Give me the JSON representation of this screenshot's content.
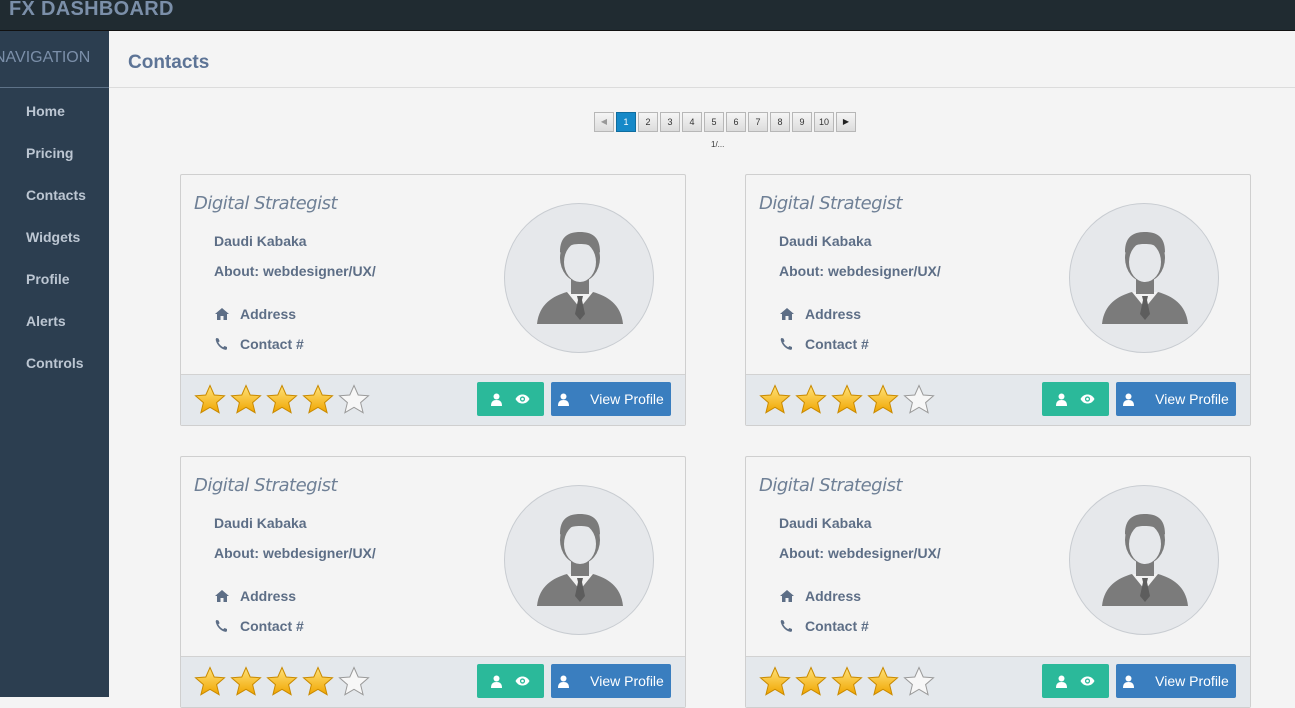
{
  "app": {
    "brand": "FX DASHBOARD"
  },
  "sidebar": {
    "header": "NAVIGATION",
    "items": [
      {
        "label": "Home",
        "name": "home"
      },
      {
        "label": "Pricing",
        "name": "pricing"
      },
      {
        "label": "Contacts",
        "name": "contacts"
      },
      {
        "label": "Widgets",
        "name": "widgets"
      },
      {
        "label": "Profile",
        "name": "profile"
      },
      {
        "label": "Alerts",
        "name": "alerts"
      },
      {
        "label": "Controls",
        "name": "controls"
      }
    ]
  },
  "page": {
    "title": "Contacts"
  },
  "pagination": {
    "prev_icon": "triangle-left-icon",
    "next_icon": "triangle-right-icon",
    "pages": [
      "1",
      "2",
      "3",
      "4",
      "5",
      "6",
      "7",
      "8",
      "9",
      "10"
    ],
    "active_page": "1",
    "info": "1/..."
  },
  "colors": {
    "accent_teal": "#2bb99a",
    "accent_blue": "#3a7ebf",
    "sidebar_bg": "#2c3e50",
    "star_gold": "#f5b400"
  },
  "contacts": [
    {
      "role": "Digital Strategist",
      "name": "Daudi Kabaka",
      "about": "About: webdesigner/UX/",
      "address_label": "Address",
      "contact_label": "Contact #",
      "rating": 4,
      "rating_max": 5,
      "view_button": "View Profile",
      "icons": [
        "home-icon",
        "phone-icon",
        "user-icon",
        "eye-icon"
      ]
    },
    {
      "role": "Digital Strategist",
      "name": "Daudi Kabaka",
      "about": "About: webdesigner/UX/",
      "address_label": "Address",
      "contact_label": "Contact #",
      "rating": 4,
      "rating_max": 5,
      "view_button": "View Profile",
      "icons": [
        "home-icon",
        "phone-icon",
        "user-icon",
        "eye-icon"
      ]
    },
    {
      "role": "Digital Strategist",
      "name": "Daudi Kabaka",
      "about": "About: webdesigner/UX/",
      "address_label": "Address",
      "contact_label": "Contact #",
      "rating": 4,
      "rating_max": 5,
      "view_button": "View Profile",
      "icons": [
        "home-icon",
        "phone-icon",
        "user-icon",
        "eye-icon"
      ]
    },
    {
      "role": "Digital Strategist",
      "name": "Daudi Kabaka",
      "about": "About: webdesigner/UX/",
      "address_label": "Address",
      "contact_label": "Contact #",
      "rating": 4,
      "rating_max": 5,
      "view_button": "View Profile",
      "icons": [
        "home-icon",
        "phone-icon",
        "user-icon",
        "eye-icon"
      ]
    }
  ]
}
